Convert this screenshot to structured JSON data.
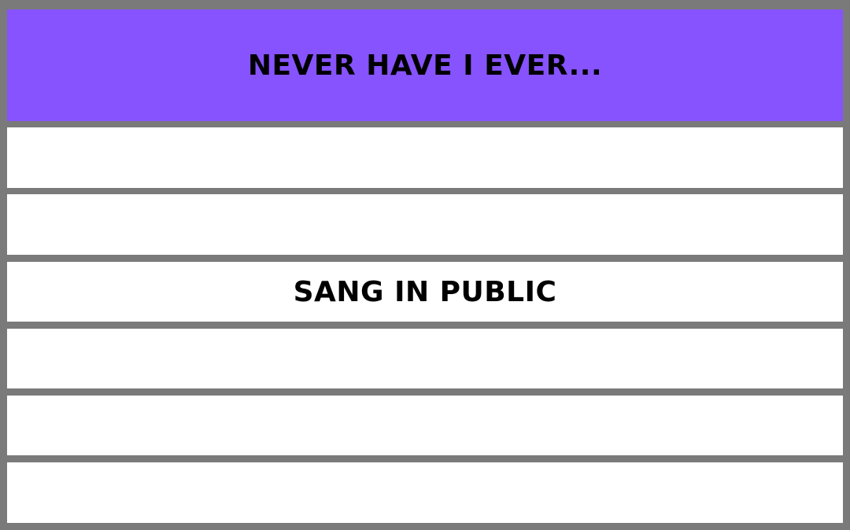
{
  "card": {
    "title": "NEVER HAVE I EVER...",
    "header_color": "#8753ff",
    "border_color": "#7a7a7a",
    "rows": [
      {
        "text": ""
      },
      {
        "text": ""
      },
      {
        "text": "SANG IN PUBLIC"
      },
      {
        "text": ""
      },
      {
        "text": ""
      },
      {
        "text": ""
      }
    ]
  }
}
